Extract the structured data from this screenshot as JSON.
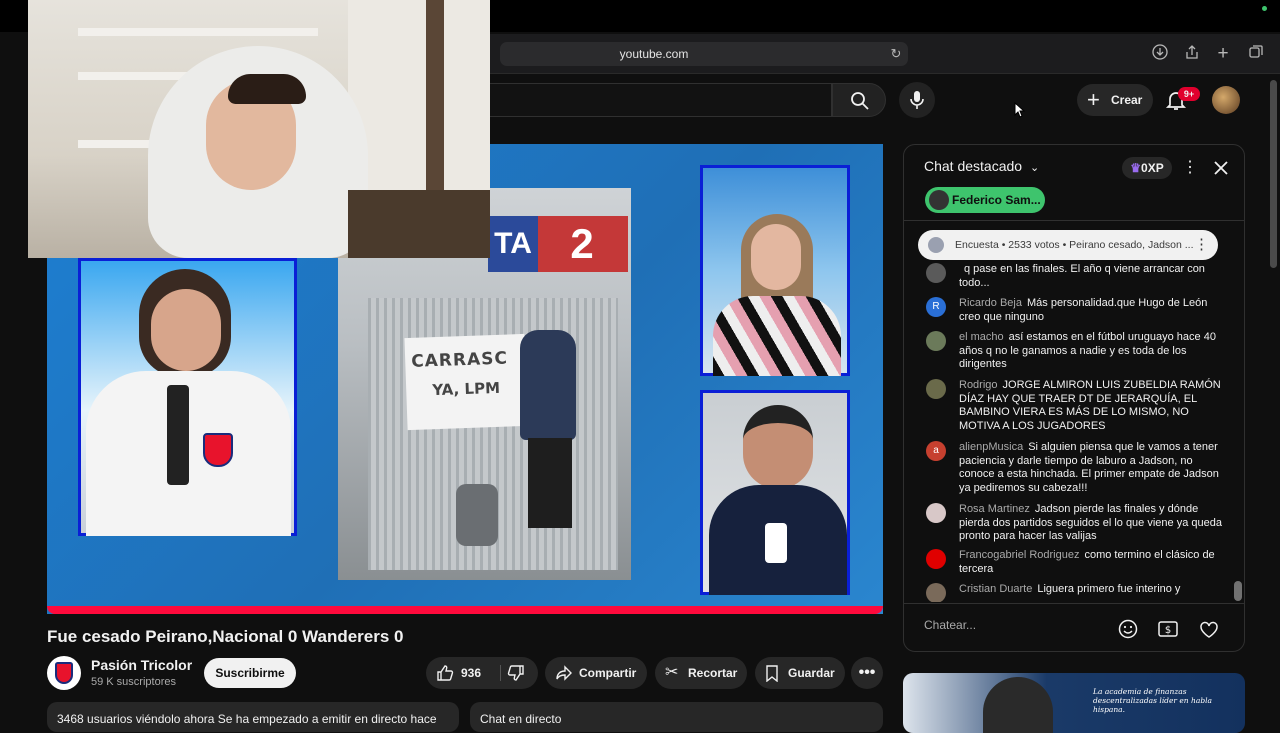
{
  "browser": {
    "url": "youtube.com"
  },
  "header": {
    "create_label": "Crear",
    "notifications_badge": "9+"
  },
  "video": {
    "scoreboard_text": "TA",
    "scoreboard_number": "2",
    "banner_text_1": "CARRASC",
    "banner_text_2": "YA, LPM",
    "title": "Fue cesado Peirano,Nacional 0 Wanderers 0"
  },
  "channel": {
    "name": "Pasión Tricolor",
    "subscribers": "59 K suscriptores",
    "subscribe_label": "Suscribirme"
  },
  "actions": {
    "likes": "936",
    "share": "Compartir",
    "clip": "Recortar",
    "save": "Guardar"
  },
  "description": {
    "preview": "3468 usuarios viéndolo ahora  Se ha empezado a emitir en directo hace"
  },
  "chat_strip": {
    "label": "Chat en directo"
  },
  "chat": {
    "title": "Chat destacado",
    "xp": "0XP",
    "chip_label": "Federico Sam...",
    "poll": "Encuesta • 2533 votos • Peirano cesado, Jadson ...",
    "input_placeholder": "Chatear...",
    "messages": [
      {
        "author": "",
        "text": "q pase en las finales. El año q viene arrancar con todo...",
        "avatar": "",
        "color": "#5a5a5a"
      },
      {
        "author": "Ricardo Beja",
        "text": "Más personalidad.que Hugo de León creo que ninguno",
        "avatar": "R",
        "color": "#2a6fd6"
      },
      {
        "author": "el macho",
        "text": "así estamos en el fútbol uruguayo hace 40 años q no le ganamos a nadie y es toda de los dirigentes",
        "avatar": "",
        "color": "#6b7a5a"
      },
      {
        "author": "Rodrigo",
        "text": "JORGE ALMIRON LUIS ZUBELDIA RAMÓN DÍAZ HAY QUE TRAER DT DE JERARQUÍA, EL BAMBINO VIERA ES MÁS DE LO MISMO, NO MOTIVA A LOS JUGADORES",
        "avatar": "",
        "color": "#6a6a4a"
      },
      {
        "author": "alienpMusica",
        "text": "Si alguien piensa que le vamos a tener paciencia y darle tiempo de laburo a Jadson, no conoce a esta hinchada. El primer empate de Jadson ya pediremos su cabeza!!!",
        "avatar": "a",
        "color": "#c6402f"
      },
      {
        "author": "Rosa Martinez",
        "text": "Jadson pierde las finales y dónde pierda dos partidos seguidos el lo que viene ya queda pronto para hacer las valijas",
        "avatar": "",
        "color": "#d8c8c8"
      },
      {
        "author": "Francogabriel Rodriguez",
        "text": "como termino el clásico de tercera",
        "avatar": "",
        "color": "#e00000"
      },
      {
        "author": "Cristian Duarte",
        "text": "Liguera primero fue interino y",
        "avatar": "",
        "color": "#7a6a5a"
      }
    ]
  },
  "ad": {
    "text": "La academia de finanzas descentralizadas líder en habla hispana."
  }
}
